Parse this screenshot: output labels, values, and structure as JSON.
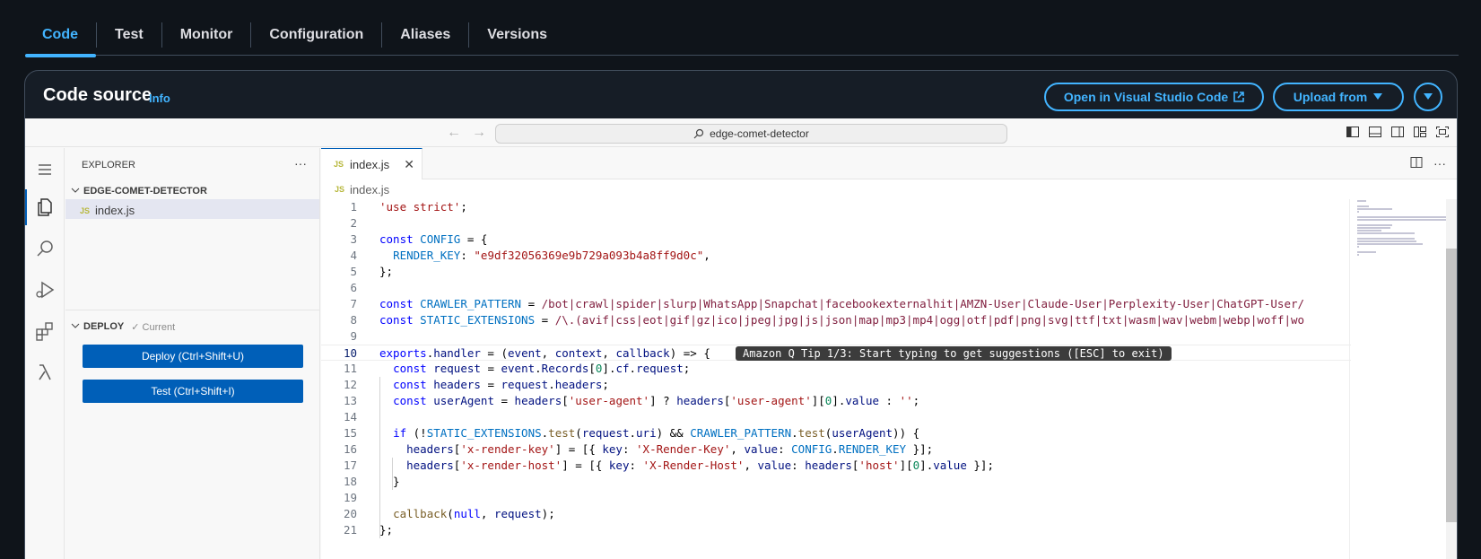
{
  "tabs": [
    "Code",
    "Test",
    "Monitor",
    "Configuration",
    "Aliases",
    "Versions"
  ],
  "panel": {
    "title": "Code source",
    "info": "Info",
    "open_vscode": "Open in Visual Studio Code",
    "upload_from": "Upload from"
  },
  "ide": {
    "search": "edge-comet-detector",
    "explorer_title": "EXPLORER",
    "folder": "EDGE-COMET-DETECTOR",
    "file": "index.js",
    "deploy_section": "DEPLOY",
    "deploy_status": "✓ Current",
    "deploy_button": "Deploy (Ctrl+Shift+U)",
    "test_button": "Test (Ctrl+Shift+I)",
    "tab_label": "index.js",
    "breadcrumb": "index.js",
    "file_badge": "JS",
    "hint": "Amazon Q Tip 1/3: Start typing to get suggestions ([ESC] to exit)"
  },
  "code_lines": [
    "'use strict';",
    "",
    "const CONFIG = {",
    "  RENDER_KEY: \"e9df32056369e9b729a093b4a8ff9d0c\",",
    "};",
    "",
    "const CRAWLER_PATTERN = /bot|crawl|spider|slurp|WhatsApp|Snapchat|facebookexternalhit|AMZN-User|Claude-User|Perplexity-User|ChatGPT-User/",
    "const STATIC_EXTENSIONS = /\\.(avif|css|eot|gif|gz|ico|jpeg|jpg|js|json|map|mp3|mp4|ogg|otf|pdf|png|svg|ttf|txt|wasm|wav|webm|webp|woff|wo",
    "",
    "exports.handler = (event, context, callback) => {",
    "  const request = event.Records[0].cf.request;",
    "  const headers = request.headers;",
    "  const userAgent = headers['user-agent'] ? headers['user-agent'][0].value : '';",
    "",
    "  if (!STATIC_EXTENSIONS.test(request.uri) && CRAWLER_PATTERN.test(userAgent)) {",
    "    headers['x-render-key'] = [{ key: 'X-Render-Key', value: CONFIG.RENDER_KEY }];",
    "    headers['x-render-host'] = [{ key: 'X-Render-Host', value: headers['host'][0].value }];",
    "  }",
    "",
    "  callback(null, request);",
    "};"
  ],
  "line_numbers": [
    "1",
    "2",
    "3",
    "4",
    "5",
    "6",
    "7",
    "8",
    "9",
    "10",
    "11",
    "12",
    "13",
    "14",
    "15",
    "16",
    "17",
    "18",
    "19",
    "20",
    "21"
  ],
  "current_line": 10,
  "colors": {
    "accent": "#42b4ff",
    "ide_blue": "#005fb8",
    "panel_bg": "#161d26"
  }
}
